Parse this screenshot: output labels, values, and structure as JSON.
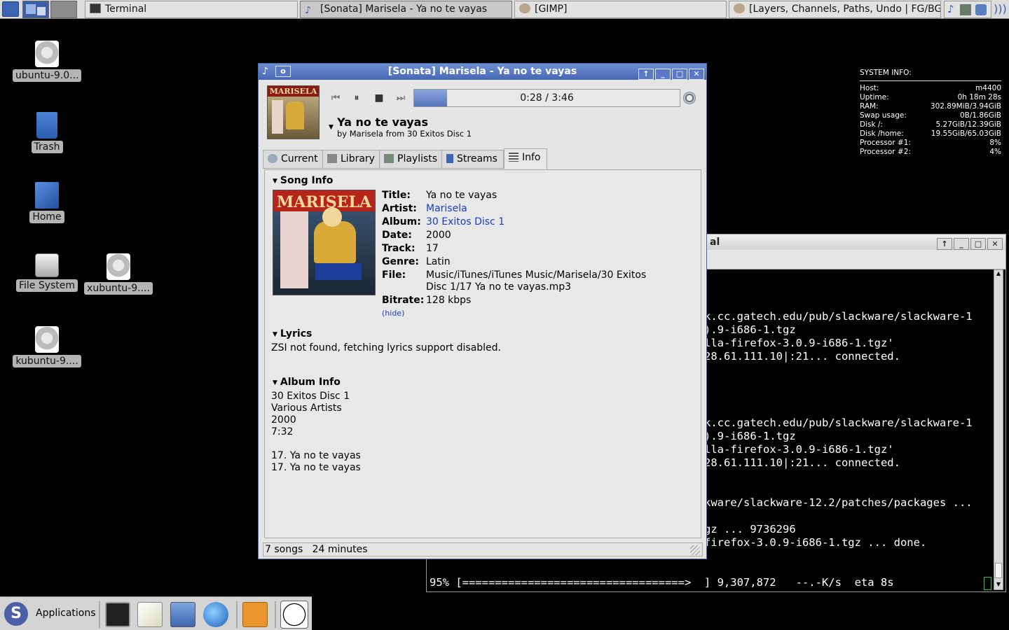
{
  "taskbar": {
    "tasks": [
      {
        "label": "Terminal"
      },
      {
        "label": "[Sonata] Marisela - Ya no te vayas"
      },
      {
        "label": "[GIMP]"
      },
      {
        "label": "[Layers, Channels, Paths, Undo | FG/BG..."
      }
    ]
  },
  "desktop": {
    "icons": [
      {
        "label": "ubuntu-9.0...",
        "icon": "iso-disc-icon"
      },
      {
        "label": "Trash",
        "icon": "trash-icon"
      },
      {
        "label": "Home",
        "icon": "home-folder-icon"
      },
      {
        "label": "File System",
        "icon": "hard-drive-icon"
      },
      {
        "label": "xubuntu-9....",
        "icon": "iso-disc-icon"
      },
      {
        "label": "kubuntu-9....",
        "icon": "iso-disc-icon"
      }
    ]
  },
  "conky": {
    "header": "SYSTEM INFO:",
    "rows": [
      {
        "k": "Host:",
        "v": "m4400"
      },
      {
        "k": "Uptime:",
        "v": "0h 18m 28s"
      },
      {
        "k": "RAM:",
        "v": "302.89MiB/3.94GiB"
      },
      {
        "k": "Swap usage:",
        "v": "0B/1.86GiB"
      },
      {
        "k": "Disk /:",
        "v": "5.27GiB/12.39GiB"
      },
      {
        "k": "Disk /home:",
        "v": "19.55GiB/65.03GiB"
      },
      {
        "k": "Processor #1:",
        "v": "8%"
      },
      {
        "k": "Processor #2:",
        "v": "4%"
      }
    ]
  },
  "terminal": {
    "title": "al",
    "lines": [
      "k.cc.gatech.edu/pub/slackware/slackware-1",
      ").9-i686-1.tgz",
      "lla-firefox-3.0.9-i686-1.tgz'",
      "28.61.111.10|:21... connected.",
      "k.cc.gatech.edu/pub/slackware/slackware-1",
      ").9-i686-1.tgz",
      "lla-firefox-3.0.9-i686-1.tgz'",
      "28.61.111.10|:21... connected.",
      "kware/slackware-12.2/patches/packages ...",
      "gz ... 9736296",
      "firefox-3.0.9-i686-1.tgz ... done.",
      "95% [==================================>  ] 9,307,872   --.-K/s  eta 8s"
    ]
  },
  "sonata": {
    "title": "[Sonata] Marisela - Ya no te vayas",
    "progress_text": "0:28 / 3:46",
    "progress_fraction": 0.124,
    "song_title": "Ya no te vayas",
    "song_sub": "by Marisela from 30 Exitos Disc 1",
    "album_art_text": "MARISELA",
    "tabs": [
      {
        "label": "Current"
      },
      {
        "label": "Library"
      },
      {
        "label": "Playlists"
      },
      {
        "label": "Streams"
      },
      {
        "label": "Info"
      }
    ],
    "song_info": {
      "header": "Song Info",
      "fields": [
        {
          "k": "Title:",
          "v": "Ya no te vayas"
        },
        {
          "k": "Artist:",
          "v": "Marisela"
        },
        {
          "k": "Album:",
          "v": "30 Exitos Disc 1"
        },
        {
          "k": "Date:",
          "v": "2000"
        },
        {
          "k": "Track:",
          "v": "17"
        },
        {
          "k": "Genre:",
          "v": "Latin"
        },
        {
          "k": "File:",
          "v": "Music/iTunes/iTunes Music/Marisela/30 Exitos Disc 1/17 Ya no te vayas.mp3"
        },
        {
          "k": "Bitrate:",
          "v": "128 kbps"
        }
      ],
      "hide": "(hide)"
    },
    "lyrics": {
      "header": "Lyrics",
      "text": "ZSI not found, fetching lyrics support disabled."
    },
    "album_info": {
      "header": "Album Info",
      "lines": [
        "30 Exitos Disc 1",
        "Various Artists",
        "2000",
        "7:32",
        "",
        "17. Ya no te vayas",
        "17. Ya no te vayas"
      ]
    },
    "status": "7 songs   24 minutes"
  },
  "bottom_panel": {
    "applications_label": "Applications"
  }
}
